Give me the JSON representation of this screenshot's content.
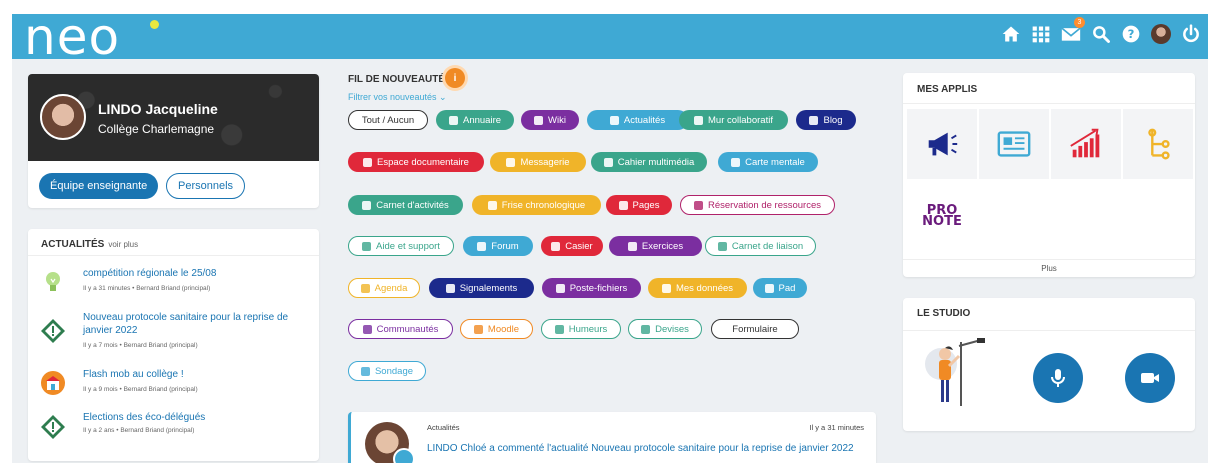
{
  "header": {
    "logo": "neo",
    "mail_badge": "3",
    "icons": [
      "home-icon",
      "apps-grid-icon",
      "mail-icon",
      "search-icon",
      "help-icon",
      "avatar",
      "power-icon"
    ]
  },
  "profile": {
    "name": "LINDO Jacqueline",
    "school": "Collège Charlemagne",
    "btn_team": "Équipe enseignante",
    "btn_staff": "Personnels"
  },
  "news": {
    "title": "ACTUALITÉS",
    "more": "voir plus",
    "items": [
      {
        "title": "compétition régionale le 25/08",
        "meta": "Il y a 31 minutes • Bernard Briand (principal)",
        "icon": "lightbulb-icon"
      },
      {
        "title": "Nouveau protocole sanitaire pour la reprise de janvier 2022",
        "meta": "Il y a 7 mois • Bernard Briand (principal)",
        "icon": "warning-diamond-icon"
      },
      {
        "title": "Flash mob au collège !",
        "meta": "Il y a 9 mois • Bernard Briand (principal)",
        "icon": "school-icon"
      },
      {
        "title": "Elections des éco-délégués",
        "meta": "Il y a 2 ans • Bernard Briand (principal)",
        "icon": "warning-diamond-icon"
      }
    ]
  },
  "feed": {
    "title": "FIL DE NOUVEAUTÉS",
    "info": "i",
    "filter": "Filtrer vos nouveautés ⌄",
    "chips": [
      {
        "label": "Tout / Aucun",
        "color": "#333333",
        "style": "outline",
        "noicon": true
      },
      {
        "label": "Annuaire",
        "color": "#3aa58b",
        "style": "filled"
      },
      {
        "label": "Wiki",
        "color": "#7b2ea0",
        "style": "filled"
      },
      {
        "label": "Actualités",
        "color": "#3fa9d4",
        "style": "filled"
      },
      {
        "label": "Mur collaboratif",
        "color": "#3aa58b",
        "style": "filled"
      },
      {
        "label": "Blog",
        "color": "#1c2a8c",
        "style": "filled"
      },
      {
        "label": "Espace documentaire",
        "color": "#e0283a",
        "style": "filled"
      },
      {
        "label": "Messagerie",
        "color": "#f0b429",
        "style": "filled"
      },
      {
        "label": "Cahier multimédia",
        "color": "#3aa58b",
        "style": "filled"
      },
      {
        "label": "Carte mentale",
        "color": "#3fa9d4",
        "style": "filled"
      },
      {
        "label": "Carnet d'activités",
        "color": "#3aa58b",
        "style": "filled"
      },
      {
        "label": "Frise chronologique",
        "color": "#f0b429",
        "style": "filled"
      },
      {
        "label": "Pages",
        "color": "#e0283a",
        "style": "filled"
      },
      {
        "label": "Réservation de ressources",
        "color": "#b0226a",
        "style": "outline"
      },
      {
        "label": "Aide et support",
        "color": "#3aa58b",
        "style": "outline"
      },
      {
        "label": "Forum",
        "color": "#3fa9d4",
        "style": "filled"
      },
      {
        "label": "Casier",
        "color": "#e0283a",
        "style": "filled"
      },
      {
        "label": "Exercices",
        "color": "#7b2ea0",
        "style": "filled"
      },
      {
        "label": "Carnet de liaison",
        "color": "#3aa58b",
        "style": "outline"
      },
      {
        "label": "Agenda",
        "color": "#f0b429",
        "style": "outline"
      },
      {
        "label": "Signalements",
        "color": "#1c2a8c",
        "style": "filled"
      },
      {
        "label": "Poste-fichiers",
        "color": "#7b2ea0",
        "style": "filled"
      },
      {
        "label": "Mes données",
        "color": "#f0b429",
        "style": "filled"
      },
      {
        "label": "Pad",
        "color": "#3fa9d4",
        "style": "filled"
      },
      {
        "label": "Communautés",
        "color": "#7b2ea0",
        "style": "outline"
      },
      {
        "label": "Moodle",
        "color": "#f08a24",
        "style": "outline"
      },
      {
        "label": "Humeurs",
        "color": "#3aa58b",
        "style": "outline"
      },
      {
        "label": "Devises",
        "color": "#3aa58b",
        "style": "outline"
      },
      {
        "label": "Formulaire",
        "color": "#333333",
        "style": "outline",
        "noicon": true
      },
      {
        "label": "Sondage",
        "color": "#3fa9d4",
        "style": "outline"
      }
    ]
  },
  "activity": {
    "category": "Actualités",
    "time": "Il y a 31 minutes",
    "text": "LINDO Chloé a commenté l'actualité Nouveau protocole sanitaire pour la reprise de janvier 2022"
  },
  "apps": {
    "title": "MES APPLIS",
    "more": "Plus",
    "items": [
      "megaphone-icon",
      "newspaper-icon",
      "chart-icon",
      "timeline-icon",
      "PRO NOTE"
    ]
  },
  "studio": {
    "title": "LE STUDIO",
    "buttons": [
      "microphone-icon",
      "video-camera-icon"
    ]
  },
  "colors": {
    "topbar": "#3fa9d4",
    "primary": "#1a75b2",
    "accent": "#f08a24"
  }
}
